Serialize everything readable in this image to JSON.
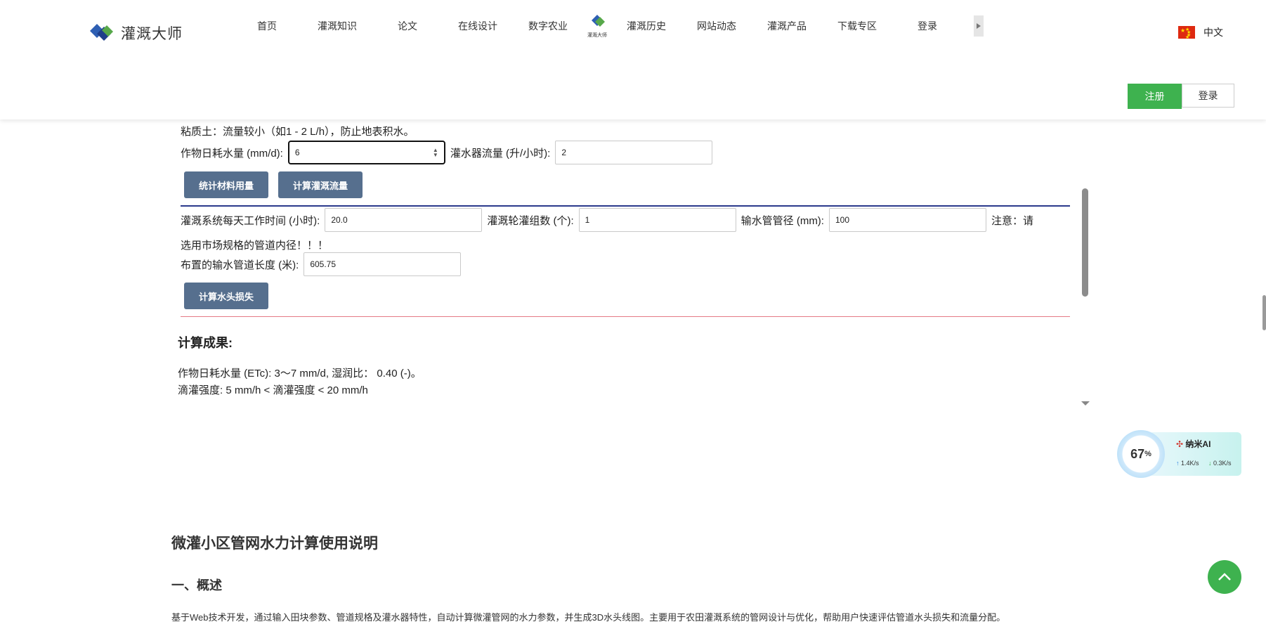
{
  "header": {
    "brand": "灌溉大师",
    "nav": [
      "首页",
      "灌溉知识",
      "论文",
      "在线设计",
      "数字农业",
      "灌溉历史",
      "网站动态",
      "灌溉产品",
      "下载专区",
      "登录"
    ],
    "nav_logo_caption": "灌溉大师",
    "language": "中文",
    "register": "注册",
    "login": "登录"
  },
  "calc": {
    "soil_note": "粘质土：流量较小（如1 - 2 L/h），防止地表积水。",
    "crop_label": "作物日耗水量 (mm/d):",
    "crop_value": "6",
    "emitter_label": "灌水器流量 (升/小时):",
    "emitter_value": "2",
    "btn_materials": "统计材料用量",
    "btn_flow": "计算灌溉流量",
    "work_label": "灌溉系统每天工作时间 (小时):",
    "work_value": "20.0",
    "rotation_label": "灌溉轮灌组数 (个):",
    "rotation_value": "1",
    "pipe_label": "输水管管径 (mm):",
    "pipe_value": "100",
    "note_a": "注意：请",
    "note_b": "选用市场规格的管道内径！！！",
    "length_label": "布置的输水管道长度 (米):",
    "length_value": "605.75",
    "btn_headloss": "计算水头损失",
    "results_title": "计算成果:",
    "result_1": "作物日耗水量 (ETc): 3～7 mm/d, 湿润比： 0.40 (-)。",
    "result_2": "滴灌强度: 5 mm/h < 滴灌强度 < 20 mm/h"
  },
  "doc": {
    "title": "微灌小区管网水力计算使用说明",
    "section1": "一、概述",
    "para": "基于Web技术开发，通过输入田块参数、管道规格及灌水器特性，自动计算微灌管网的水力参数，并生成3D水头线图。主要用于农田灌溉系统的管网设计与优化，帮助用户快速评估管道水头损失和流量分配。"
  },
  "ai": {
    "percent": "67",
    "percent_unit": "%",
    "name": "纳米AI",
    "up": "1.4K/s",
    "down": "0.3K/s"
  }
}
